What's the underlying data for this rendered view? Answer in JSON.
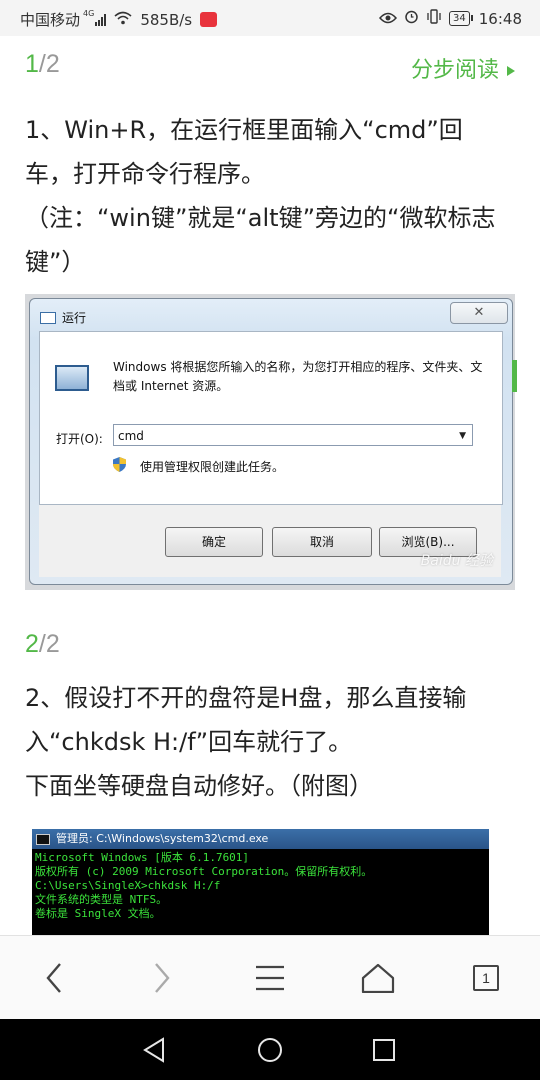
{
  "status_bar": {
    "carrier": "中国移动",
    "network": "4G",
    "speed": "585B/s",
    "battery": "34",
    "time": "16:48"
  },
  "article": {
    "step1": {
      "current": "1",
      "total": "/2",
      "read_by_step": "分步阅读",
      "lines": [
        "1、Win+R，在运行框里面输入“cmd”回车，打开命令行程序。",
        "（注：“win键”就是“alt键”旁边的“微软标志键”）"
      ],
      "run_dialog": {
        "title": "运行",
        "close": "✕",
        "description": "Windows 将根据您所输入的名称，为您打开相应的程序、文件夹、文档或 Internet 资源。",
        "open_label": "打开(O):",
        "input_value": "cmd",
        "admin_note": "使用管理权限创建此任务。",
        "ok": "确定",
        "cancel": "取消",
        "browse": "浏览(B)...",
        "watermark": "Baidu 经验"
      }
    },
    "step2": {
      "current": "2",
      "total": "/2",
      "lines": [
        "2、假设打不开的盘符是H盘，那么直接输入“chkdsk H:/f”回车就行了。",
        "下面坐等硬盘自动修好。（附图）"
      ],
      "cmd_window": {
        "title": "管理员: C:\\Windows\\system32\\cmd.exe",
        "lines": [
          "Microsoft Windows [版本 6.1.7601]",
          "版权所有 (c) 2009 Microsoft Corporation。保留所有权利。",
          "",
          "C:\\Users\\SingleX>chkdsk H:/f",
          "文件系统的类型是 NTFS。",
          "卷标是 SingleX 文档。"
        ]
      }
    }
  },
  "toolbar": {
    "tab_count": "1"
  }
}
